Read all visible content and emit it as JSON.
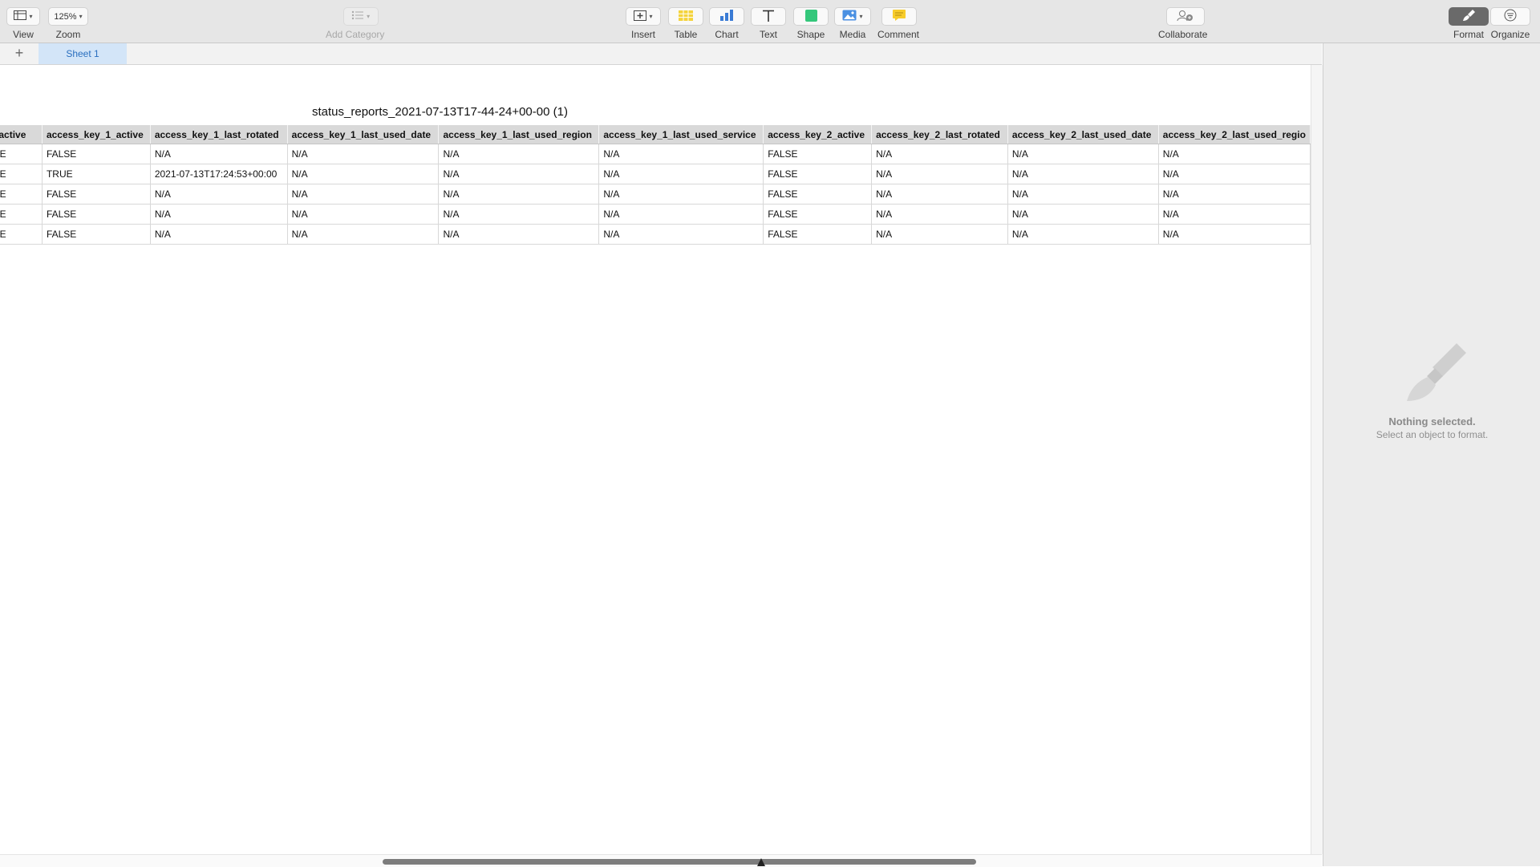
{
  "toolbar": {
    "view": {
      "label": "View",
      "icon": "sidebar-icon"
    },
    "zoom": {
      "label": "Zoom",
      "value": "125%"
    },
    "add_category": {
      "label": "Add Category",
      "icon": "list-icon"
    },
    "insert": {
      "label": "Insert",
      "icon": "insert-icon"
    },
    "table": {
      "label": "Table",
      "icon": "table-icon"
    },
    "chart": {
      "label": "Chart",
      "icon": "chart-icon"
    },
    "text": {
      "label": "Text",
      "icon": "text-icon"
    },
    "shape": {
      "label": "Shape",
      "icon": "shape-icon"
    },
    "media": {
      "label": "Media",
      "icon": "media-icon"
    },
    "comment": {
      "label": "Comment",
      "icon": "comment-icon"
    },
    "collaborate": {
      "label": "Collaborate",
      "icon": "collaborate-icon"
    },
    "format": {
      "label": "Format",
      "icon": "paintbrush-icon"
    },
    "organize": {
      "label": "Organize",
      "icon": "organize-icon"
    }
  },
  "sheets": {
    "add_icon": "+",
    "tabs": [
      {
        "label": "Sheet 1",
        "active": true
      }
    ]
  },
  "table": {
    "title": "status_reports_2021-07-13T17-44-24+00-00 (1)",
    "columns": [
      "a_active",
      "access_key_1_active",
      "access_key_1_last_rotated",
      "access_key_1_last_used_date",
      "access_key_1_last_used_region",
      "access_key_1_last_used_service",
      "access_key_2_active",
      "access_key_2_last_rotated",
      "access_key_2_last_used_date",
      "access_key_2_last_used_regio"
    ],
    "rows": [
      [
        "LSE",
        "FALSE",
        "N/A",
        "N/A",
        "N/A",
        "N/A",
        "FALSE",
        "N/A",
        "N/A",
        "N/A"
      ],
      [
        "LSE",
        "TRUE",
        "2021-07-13T17:24:53+00:00",
        "N/A",
        "N/A",
        "N/A",
        "FALSE",
        "N/A",
        "N/A",
        "N/A"
      ],
      [
        "LSE",
        "FALSE",
        "N/A",
        "N/A",
        "N/A",
        "N/A",
        "FALSE",
        "N/A",
        "N/A",
        "N/A"
      ],
      [
        "LSE",
        "FALSE",
        "N/A",
        "N/A",
        "N/A",
        "N/A",
        "FALSE",
        "N/A",
        "N/A",
        "N/A"
      ],
      [
        "LSE",
        "FALSE",
        "N/A",
        "N/A",
        "N/A",
        "N/A",
        "FALSE",
        "N/A",
        "N/A",
        "N/A"
      ]
    ]
  },
  "format_panel": {
    "title": "Nothing selected.",
    "subtitle": "Select an object to format."
  },
  "colors": {
    "accent": "#2a6fbf",
    "sheet_tab_bg": "#d3e5f8",
    "header_bg": "#d9d9d9",
    "toolbar_bg": "#e6e6e6"
  }
}
